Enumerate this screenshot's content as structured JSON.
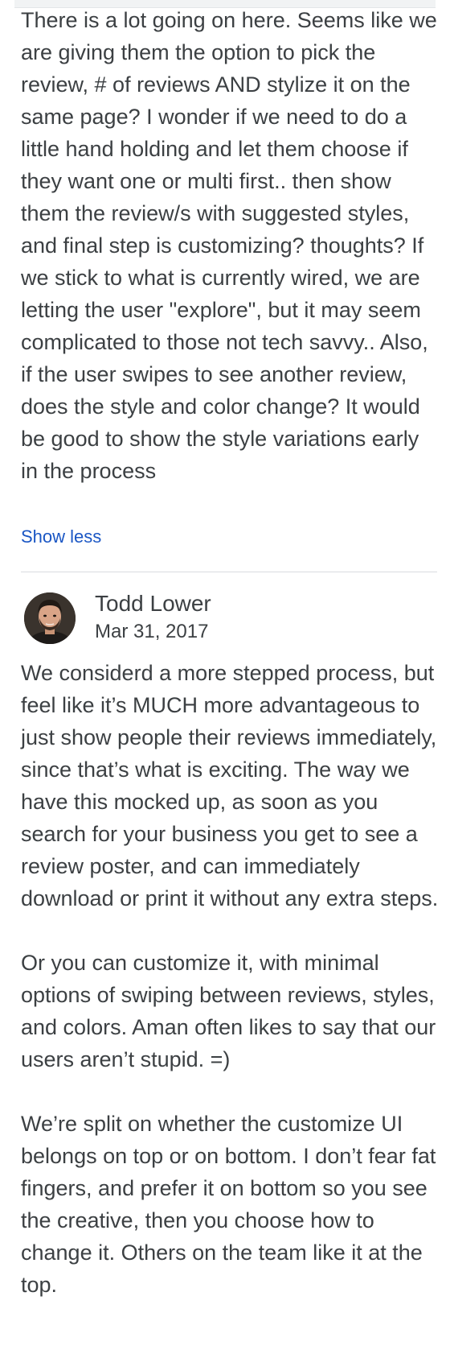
{
  "thread": {
    "first_comment": {
      "text": "There is a lot going on here. Seems like we are giving them the option to pick the review, # of reviews AND stylize it on the same page? I wonder if we need to do a little hand holding and let them choose if they want one or multi first.. then show them the review/s with suggested styles, and final step is customizing? thoughts? If we stick to what is currently wired, we are letting the user \"explore\", but it may seem complicated to those not tech savvy.. Also, if the user swipes to see another review, does the style and color change? It would be good to show the style variations early in the process",
      "show_less_label": "Show less"
    },
    "second_comment": {
      "author": "Todd Lower",
      "date": "Mar 31, 2017",
      "avatar_icon": "person-avatar-icon",
      "paragraphs": [
        "We considerd a more stepped process, but feel like it’s MUCH more advantageous to just show people their reviews immediately, since that’s what is exciting. The way we have this mocked up, as soon as you search for your business you get to see a review poster, and can immediately download or print it without any extra steps.",
        "Or you can customize it, with minimal options of swiping between reviews, styles, and colors. Aman often likes to say that our users aren’t stupid. =)",
        "We’re split on whether the customize UI belongs on top or on bottom. I don’t fear fat fingers, and prefer it on bottom so you see the creative, then you choose how to change it. Others on the team like it at the top."
      ]
    }
  },
  "colors": {
    "text": "#3c4043",
    "link": "#1a56c4",
    "divider": "#dadce0"
  }
}
